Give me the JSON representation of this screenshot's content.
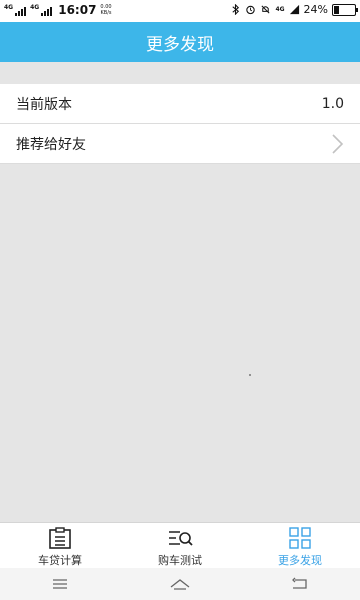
{
  "status_bar": {
    "sim1": "4G",
    "sim2": "4G",
    "time": "16:07",
    "net_speed_value": "0.00",
    "net_speed_unit": "KB/s",
    "network_badge": "4G",
    "battery": "24%"
  },
  "header": {
    "title": "更多发现"
  },
  "list": {
    "items": [
      {
        "label": "当前版本",
        "value": "1.0"
      },
      {
        "label": "推荐给好友",
        "icon": "chevron-right-icon"
      }
    ]
  },
  "tabs": [
    {
      "label": "车贷计算",
      "icon": "clipboard-icon",
      "active": false
    },
    {
      "label": "购车测试",
      "icon": "search-list-icon",
      "active": false
    },
    {
      "label": "更多发现",
      "icon": "grid-icon",
      "active": true
    }
  ],
  "colors": {
    "accent": "#3db6e9",
    "active_tab": "#3aa2e6",
    "background": "#e5e5e5"
  },
  "system_nav": [
    "menu-icon",
    "home-icon",
    "back-icon"
  ]
}
